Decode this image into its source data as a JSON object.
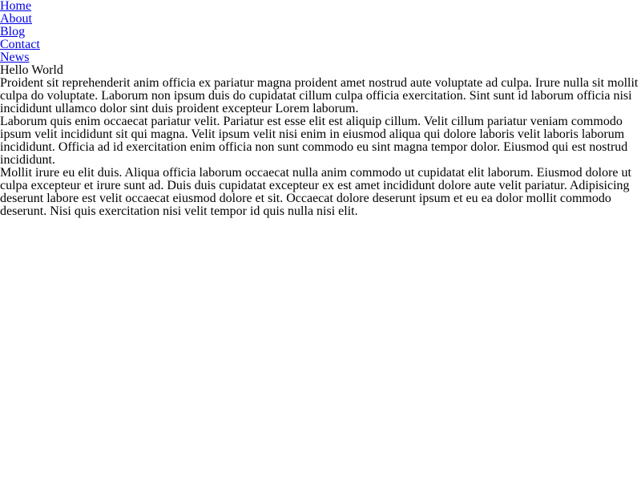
{
  "nav": {
    "items": [
      {
        "label": "Home"
      },
      {
        "label": "About"
      },
      {
        "label": "Blog"
      },
      {
        "label": "Contact"
      },
      {
        "label": "News"
      }
    ]
  },
  "main": {
    "title": "Hello World",
    "paragraphs": [
      "Proident sit reprehenderit anim officia ex pariatur magna proident amet nostrud aute voluptate ad culpa. Irure nulla sit mollit culpa do voluptate. Laborum non ipsum duis do cupidatat cillum culpa officia exercitation. Sint sunt id laborum officia nisi incididunt ullamco dolor sint duis proident excepteur Lorem laborum.",
      "Laborum quis enim occaecat pariatur velit. Pariatur est esse elit est aliquip cillum. Velit cillum pariatur veniam commodo ipsum velit incididunt sit qui magna. Velit ipsum velit nisi enim in eiusmod aliqua qui dolore laboris velit laboris laborum incididunt. Officia ad id exercitation enim officia non sunt commodo eu sint magna tempor dolor. Eiusmod qui est nostrud incididunt.",
      "Mollit irure eu elit duis. Aliqua officia laborum occaecat nulla anim commodo ut cupidatat elit laborum. Eiusmod dolore ut culpa excepteur et irure sunt ad. Duis duis cupidatat excepteur ex est amet incididunt dolore aute velit pariatur. Adipisicing deserunt labore est velit occaecat eiusmod dolore et sit. Occaecat dolore deserunt ipsum et eu ea dolor mollit commodo deserunt. Nisi quis exercitation nisi velit tempor id quis nulla nisi elit."
    ]
  },
  "colors": {
    "link": "#0000ee",
    "text": "#000000",
    "background": "#ffffff"
  }
}
